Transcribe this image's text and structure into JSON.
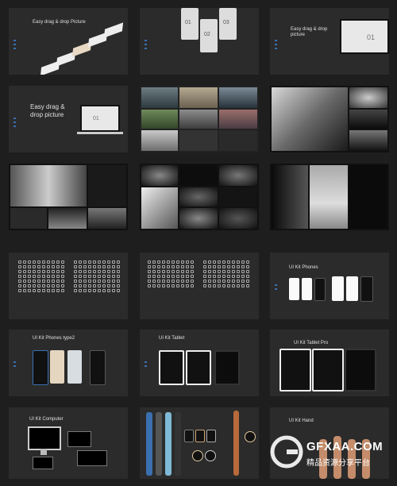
{
  "slides": {
    "s1": {
      "title": "Easy drag & drop Picture"
    },
    "s2": {
      "labels": [
        "01",
        "02",
        "03"
      ]
    },
    "s3": {
      "title": "Easy drag & drop picture",
      "num": "01"
    },
    "s4": {
      "title": "Easy drag & drop picture",
      "num": "01"
    },
    "s13": {
      "title": "UI Kit Phones"
    },
    "s14": {
      "title": "UI Kit Phones type2"
    },
    "s15": {
      "title": "UI Kit Tablet"
    },
    "s16": {
      "title": "UI Kit Tablet Pro"
    },
    "s17": {
      "title": "UI Kit Computer"
    },
    "s19": {
      "title": "UI Kit Hand"
    }
  },
  "watermark": {
    "brand": "GFXAA.COM",
    "tagline": "精品资源分享平台"
  },
  "colors": {
    "bg": "#1e1e1e",
    "slide": "#2b2b2b",
    "accent": "#3a6fb0"
  }
}
